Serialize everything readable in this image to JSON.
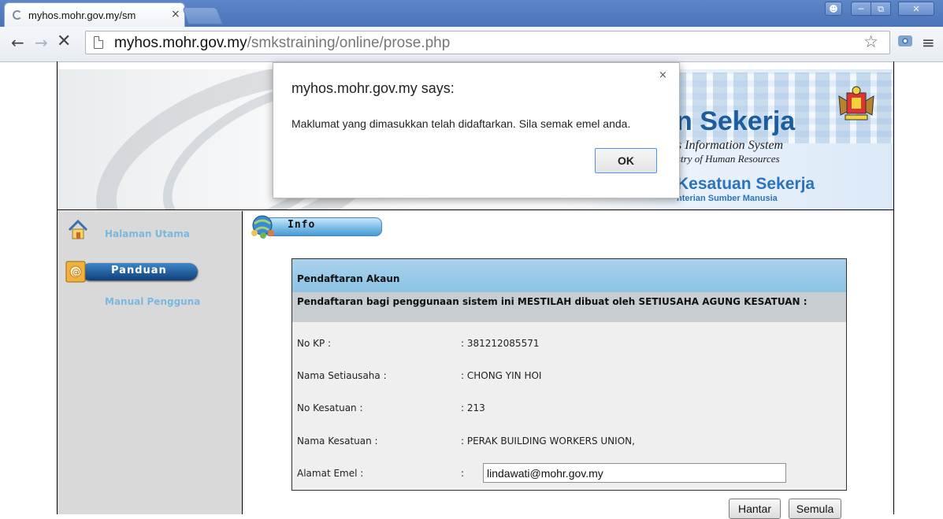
{
  "browser": {
    "tab_title": "myhos.mohr.gov.my/sm",
    "tab_close": "×",
    "url_host": "myhos.mohr.gov.my",
    "url_path": "/smkstraining/online/prose.php",
    "icons": [
      "back-arrow-icon",
      "forward-arrow-icon",
      "stop-icon",
      "page-icon",
      "star-icon",
      "camera-icon",
      "menu-icon"
    ]
  },
  "banner": {
    "title": "n Sekerja",
    "subtitle1": "s Information System",
    "subtitle2": "stry of Human Resources",
    "ks_title": "Kesatuan Sekerja",
    "ks_sub": "nterian Sumber Manusia"
  },
  "sidebar": {
    "home_label": "Halaman Utama",
    "panduan_label": "Panduan",
    "manual_label": "Manual Pengguna"
  },
  "info": {
    "label": "Info"
  },
  "form": {
    "header": "Pendaftaran Akaun",
    "subheader": "Pendaftaran bagi penggunaan sistem ini MESTILAH dibuat oleh SETIUSAHA AGUNG KESATUAN :",
    "rows": [
      {
        "label": "No KP :",
        "value": ": 381212085571"
      },
      {
        "label": "Nama Setiausaha :",
        "value": ": CHONG YIN HOI"
      },
      {
        "label": "No Kesatuan :",
        "value": ": 213"
      },
      {
        "label": "Nama Kesatuan :",
        "value": ": PERAK BUILDING WORKERS UNION,"
      }
    ],
    "email_label": "Alamat Emel :",
    "email_colon": ":",
    "email_value": "lindawati@mohr.gov.my",
    "submit_label": "Hantar",
    "reset_label": "Semula"
  },
  "dialog": {
    "title": "myhos.mohr.gov.my says:",
    "message": "Maklumat yang dimasukkan telah didaftarkan. Sila semak emel anda.",
    "ok_label": "OK",
    "close_label": "×"
  }
}
